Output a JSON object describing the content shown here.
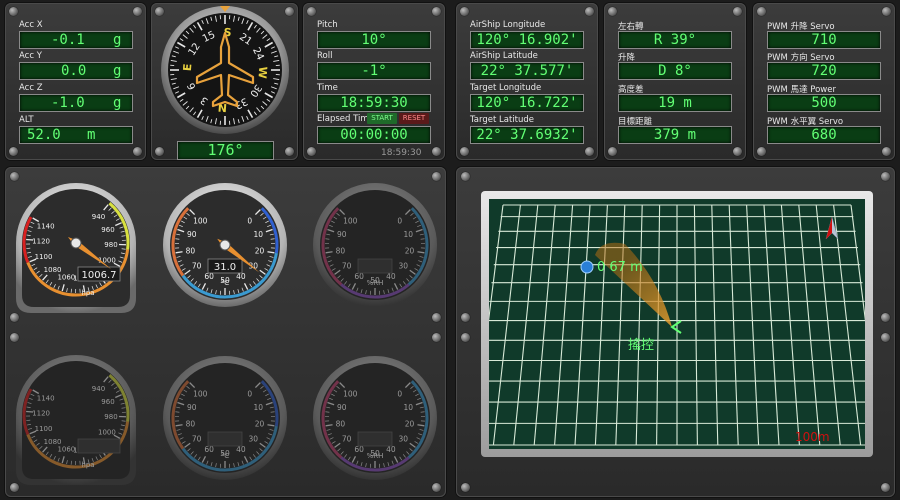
{
  "accel": {
    "rows": [
      {
        "label": "Acc X",
        "value": "-0.1",
        "unit": "g"
      },
      {
        "label": "Acc Y",
        "value": "0.0",
        "unit": "g"
      },
      {
        "label": "Acc Z",
        "value": "-1.0",
        "unit": "g"
      },
      {
        "label": "ALT",
        "value": "52.0",
        "unit": "m"
      }
    ]
  },
  "compass": {
    "heading_readout": "176°",
    "heading_deg": 176,
    "dial_numbers": [
      "3",
      "6",
      "12",
      "15",
      "21",
      "24",
      "30",
      "33"
    ],
    "dial_letters": [
      "N",
      "E",
      "S",
      "W"
    ]
  },
  "attitude": {
    "pitch_label": "Pitch",
    "pitch_value": "10°",
    "roll_label": "Roll",
    "roll_value": "-1°",
    "time_label": "Time",
    "time_value": "18:59:30",
    "elapsed_label": "Elapsed Time",
    "elapsed_value": "00:00:00",
    "start_label": "START",
    "reset_label": "RESET",
    "clock_small": "18:59:30"
  },
  "gps": {
    "rows": [
      {
        "label": "AirShip Longitude",
        "value": "120° 16.902'"
      },
      {
        "label": "AirShip Latitude",
        "value": "22° 37.577'"
      },
      {
        "label": "Target Longitude",
        "value": "120° 16.722'"
      },
      {
        "label": "Target Latitude",
        "value": "22° 37.6932'"
      }
    ]
  },
  "nav": {
    "rows": [
      {
        "label": "左右轉",
        "value": "R 39°"
      },
      {
        "label": "升降",
        "value": "D 8°"
      },
      {
        "label": "高度差",
        "value": "19 m"
      },
      {
        "label": "目標距離",
        "value": "379 m"
      }
    ]
  },
  "pwm": {
    "rows": [
      {
        "label": "PWM 升降 Servo",
        "value": "710"
      },
      {
        "label": "PWM 方向 Servo",
        "value": "720"
      },
      {
        "label": "PWM 馬達 Power",
        "value": "500"
      },
      {
        "label": "PWM 水平翼 Servo",
        "value": "680"
      }
    ]
  },
  "gauges": {
    "pressure_top": {
      "ticks": [
        "940",
        "960",
        "980",
        "1000",
        "1020",
        "1040",
        "1060",
        "1080",
        "1100",
        "1120",
        "1140"
      ],
      "unit": "hpa",
      "readout": "1006.7",
      "value": 1006.7
    },
    "temp_top": {
      "ticks": [
        "0",
        "10",
        "20",
        "30",
        "40",
        "50",
        "60",
        "70",
        "80",
        "90",
        "100"
      ],
      "unit": "°C",
      "readout": "31.0",
      "value": 31.0
    },
    "humidity_top": {
      "ticks": [
        "0",
        "10",
        "20",
        "30",
        "40",
        "50",
        "60",
        "70",
        "80",
        "90",
        "100"
      ],
      "unit": "%RH"
    },
    "pressure_bottom": {
      "ticks": [
        "940",
        "960",
        "980",
        "1000",
        "1020",
        "1040",
        "1060",
        "1080",
        "1100",
        "1120",
        "1140"
      ],
      "unit": "hpa"
    },
    "temp_bottom": {
      "ticks": [
        "0",
        "10",
        "20",
        "30",
        "40",
        "50",
        "60",
        "70",
        "80",
        "90",
        "100"
      ],
      "unit": "°C"
    },
    "humidity_bottom": {
      "ticks": [
        "0",
        "10",
        "20",
        "30",
        "40",
        "50",
        "60",
        "70",
        "80",
        "90",
        "100"
      ],
      "unit": "%RH"
    }
  },
  "map": {
    "target_distance_label": "0 67 m",
    "control_label": "搖控",
    "scale_label": "100m"
  },
  "colors": {
    "lcd_bg": "#0a3d14",
    "lcd_text": "#62ff74",
    "map_bg": "#103a2a",
    "map_grid": "#d8ead8",
    "accent_red": "#d01010"
  }
}
